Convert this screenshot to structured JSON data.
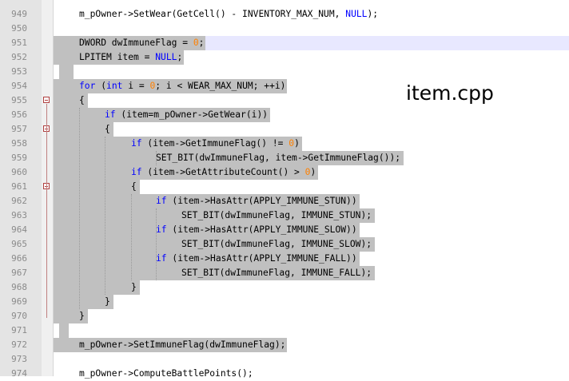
{
  "editor": {
    "file_label": "item.cpp",
    "lines": [
      {
        "no": "949",
        "text": "    m_pOwner->SetWear(GetCell() - INVENTORY_MAX_NUM, NULL);"
      },
      {
        "no": "950",
        "text": ""
      },
      {
        "no": "951",
        "text": "    DWORD dwImmuneFlag = 0;"
      },
      {
        "no": "952",
        "text": "    LPITEM item = NULL;"
      },
      {
        "no": "953",
        "text": ""
      },
      {
        "no": "954",
        "text": "    for (int i = 0; i < WEAR_MAX_NUM; ++i)"
      },
      {
        "no": "955",
        "text": "    {"
      },
      {
        "no": "956",
        "text": "        if (item=m_pOwner->GetWear(i))"
      },
      {
        "no": "957",
        "text": "        {"
      },
      {
        "no": "958",
        "text": "            if (item->GetImmuneFlag() != 0)"
      },
      {
        "no": "959",
        "text": "                SET_BIT(dwImmuneFlag, item->GetImmuneFlag());"
      },
      {
        "no": "960",
        "text": "            if (item->GetAttributeCount() > 0)"
      },
      {
        "no": "961",
        "text": "            {"
      },
      {
        "no": "962",
        "text": "                if (item->HasAttr(APPLY_IMMUNE_STUN))"
      },
      {
        "no": "963",
        "text": "                    SET_BIT(dwImmuneFlag, IMMUNE_STUN);"
      },
      {
        "no": "964",
        "text": "                if (item->HasAttr(APPLY_IMMUNE_SLOW))"
      },
      {
        "no": "965",
        "text": "                    SET_BIT(dwImmuneFlag, IMMUNE_SLOW);"
      },
      {
        "no": "966",
        "text": "                if (item->HasAttr(APPLY_IMMUNE_FALL))"
      },
      {
        "no": "967",
        "text": "                    SET_BIT(dwImmuneFlag, IMMUNE_FALL);"
      },
      {
        "no": "968",
        "text": "            }"
      },
      {
        "no": "969",
        "text": "        }"
      },
      {
        "no": "970",
        "text": "    }"
      },
      {
        "no": "971",
        "text": ""
      },
      {
        "no": "972",
        "text": "    m_pOwner->SetImmuneFlag(dwImmuneFlag);"
      },
      {
        "no": "973",
        "text": ""
      },
      {
        "no": "974",
        "text": "    m_pOwner->ComputeBattlePoints();"
      }
    ],
    "fold_markers": [
      "955",
      "957",
      "961"
    ],
    "colors": {
      "keyword": "#0000ff",
      "number": "#ff8000",
      "selection": "#c0c0c0",
      "current_line": "#e8e8ff"
    }
  }
}
